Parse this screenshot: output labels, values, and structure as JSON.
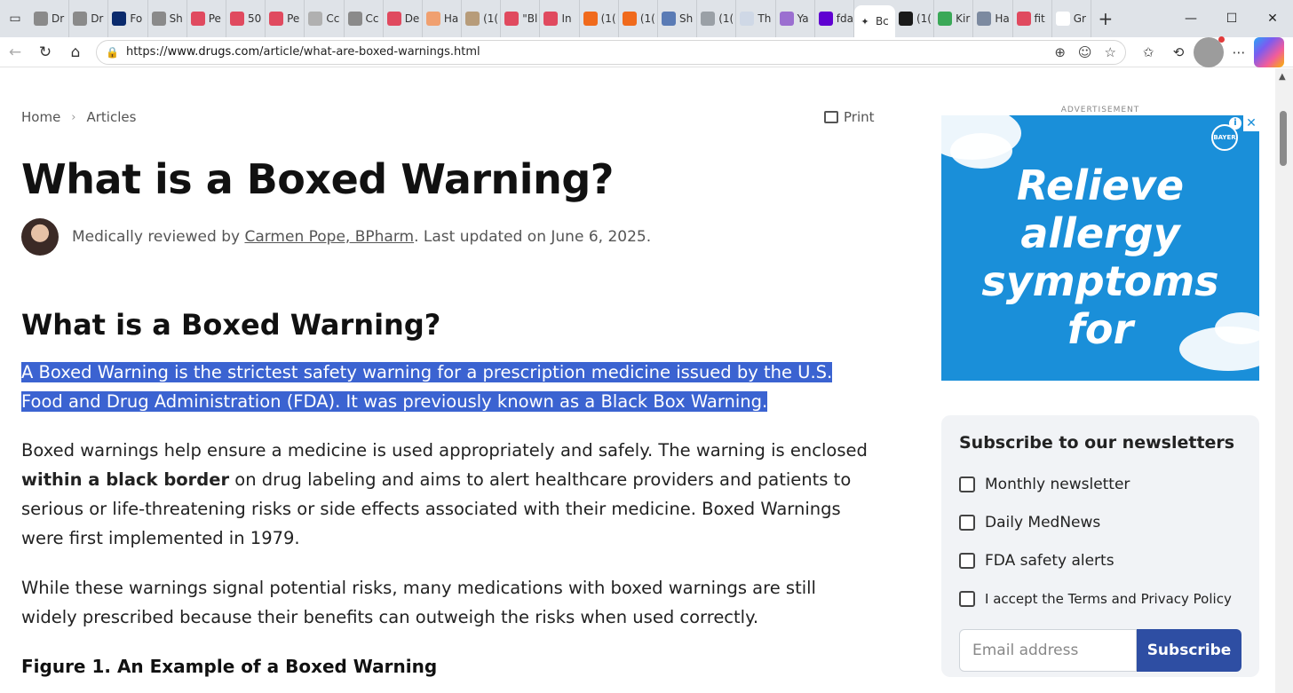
{
  "browser": {
    "tabs": [
      {
        "label": "Dr",
        "icon": "globe-icon",
        "color": "#8a8a8a"
      },
      {
        "label": "Dr",
        "icon": "globe-icon",
        "color": "#8a8a8a"
      },
      {
        "label": "Fo",
        "icon": "fox-news-icon",
        "color": "#0a2a6c"
      },
      {
        "label": "Sh",
        "icon": "globe-icon",
        "color": "#8a8a8a"
      },
      {
        "label": "Pe",
        "icon": "youtube-icon",
        "color": "#e04a5f"
      },
      {
        "label": "50",
        "icon": "youtube-icon",
        "color": "#e04a5f"
      },
      {
        "label": "Pe",
        "icon": "youtube-icon",
        "color": "#e04a5f"
      },
      {
        "label": "Cc",
        "icon": "seal-icon",
        "color": "#b0b0b0"
      },
      {
        "label": "Cc",
        "icon": "globe-icon",
        "color": "#8a8a8a"
      },
      {
        "label": "De",
        "icon": "youtube-icon",
        "color": "#e04a5f"
      },
      {
        "label": "Ha",
        "icon": "b-icon",
        "color": "#f0a070"
      },
      {
        "label": "(1(",
        "icon": "image-icon",
        "color": "#b79c7a"
      },
      {
        "label": "\"Bl",
        "icon": "youtube-icon",
        "color": "#e04a5f"
      },
      {
        "label": "In",
        "icon": "youtube-icon",
        "color": "#e04a5f"
      },
      {
        "label": "(1(",
        "icon": "substack-icon",
        "color": "#f06a1c"
      },
      {
        "label": "(1(",
        "icon": "substack-icon",
        "color": "#f06a1c"
      },
      {
        "label": "Sh",
        "icon": "m-icon",
        "color": "#5a7bb5"
      },
      {
        "label": "(1(",
        "icon": "image-icon",
        "color": "#9aa0a6"
      },
      {
        "label": "Th",
        "icon": "gp-icon",
        "color": "#cfd8e6"
      },
      {
        "label": "Ya",
        "icon": "yahoo-icon",
        "color": "#9b6fd0"
      },
      {
        "label": "fda",
        "icon": "yahoo-icon",
        "color": "#5f01d1"
      }
    ],
    "active_tab": {
      "label": "Bc",
      "icon": "drugs-com-icon"
    },
    "tabs_after": [
      {
        "label": "(1(",
        "icon": "fp-icon",
        "color": "#1a1a1a"
      },
      {
        "label": "Kir",
        "icon": "book-icon",
        "color": "#3aa857"
      },
      {
        "label": "Ha",
        "icon": "image-icon",
        "color": "#7c8aa0"
      },
      {
        "label": "fit",
        "icon": "youtube-icon",
        "color": "#e04a5f"
      },
      {
        "label": "Gr",
        "icon": "google-icon",
        "color": "#ffffff"
      }
    ],
    "url_prefix": "https://",
    "url_domain": "www.drugs.com",
    "url_path": "/article/what-are-boxed-warnings.html"
  },
  "breadcrumb": {
    "home": "Home",
    "articles": "Articles"
  },
  "print_label": "Print",
  "article": {
    "title": "What is a Boxed Warning?",
    "byline_prefix": "Medically reviewed by ",
    "reviewer": "Carmen Pope, BPharm",
    "byline_suffix": ". Last updated on June 6, 2025.",
    "section_heading": "What is a Boxed Warning?",
    "p1": "A Boxed Warning is the strictest safety warning for a prescription medicine issued by the U.S. Food and Drug Administration (FDA). It was previously known as a Black Box Warning.",
    "p2_a": "Boxed warnings help ensure a medicine is used appropriately and safely. The warning is enclosed ",
    "p2_bold": "within a black border",
    "p2_b": " on drug labeling and aims to alert healthcare providers and patients to serious or life-threatening risks or side effects associated with their medicine. Boxed Warnings were first implemented in 1979.",
    "p3": "While these warnings signal potential risks, many medications with boxed warnings are still widely prescribed because their benefits can outweigh the risks when used correctly.",
    "figure_heading": "Figure 1. An Example of a Boxed Warning"
  },
  "ad": {
    "label": "ADVERTISEMENT",
    "headline_1": "Relieve",
    "headline_2": "allergy",
    "headline_3": "symptoms",
    "headline_4": "for",
    "brand": "BAYER"
  },
  "newsletter": {
    "heading": "Subscribe to our newsletters",
    "options": [
      "Monthly newsletter",
      "Daily MedNews",
      "FDA safety alerts"
    ],
    "terms": "I accept the Terms and Privacy Policy",
    "email_placeholder": "Email address",
    "subscribe_label": "Subscribe"
  },
  "colors": {
    "accent": "#2e4ea3",
    "selection": "#3b63d1",
    "ad_bg": "#1a8fd9"
  }
}
